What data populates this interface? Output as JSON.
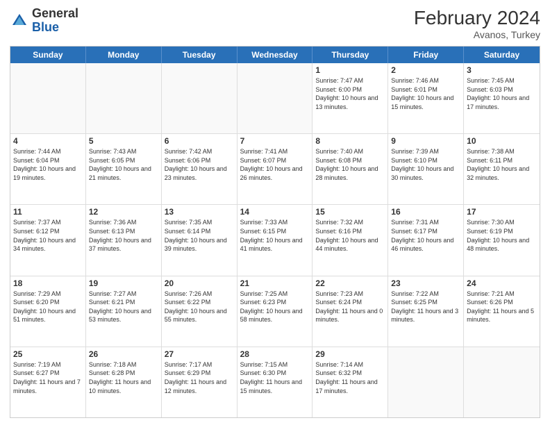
{
  "header": {
    "logo_general": "General",
    "logo_blue": "Blue",
    "month_year": "February 2024",
    "location": "Avanos, Turkey"
  },
  "weekdays": [
    "Sunday",
    "Monday",
    "Tuesday",
    "Wednesday",
    "Thursday",
    "Friday",
    "Saturday"
  ],
  "rows": [
    [
      {
        "day": "",
        "info": ""
      },
      {
        "day": "",
        "info": ""
      },
      {
        "day": "",
        "info": ""
      },
      {
        "day": "",
        "info": ""
      },
      {
        "day": "1",
        "info": "Sunrise: 7:47 AM\nSunset: 6:00 PM\nDaylight: 10 hours and 13 minutes."
      },
      {
        "day": "2",
        "info": "Sunrise: 7:46 AM\nSunset: 6:01 PM\nDaylight: 10 hours and 15 minutes."
      },
      {
        "day": "3",
        "info": "Sunrise: 7:45 AM\nSunset: 6:03 PM\nDaylight: 10 hours and 17 minutes."
      }
    ],
    [
      {
        "day": "4",
        "info": "Sunrise: 7:44 AM\nSunset: 6:04 PM\nDaylight: 10 hours and 19 minutes."
      },
      {
        "day": "5",
        "info": "Sunrise: 7:43 AM\nSunset: 6:05 PM\nDaylight: 10 hours and 21 minutes."
      },
      {
        "day": "6",
        "info": "Sunrise: 7:42 AM\nSunset: 6:06 PM\nDaylight: 10 hours and 23 minutes."
      },
      {
        "day": "7",
        "info": "Sunrise: 7:41 AM\nSunset: 6:07 PM\nDaylight: 10 hours and 26 minutes."
      },
      {
        "day": "8",
        "info": "Sunrise: 7:40 AM\nSunset: 6:08 PM\nDaylight: 10 hours and 28 minutes."
      },
      {
        "day": "9",
        "info": "Sunrise: 7:39 AM\nSunset: 6:10 PM\nDaylight: 10 hours and 30 minutes."
      },
      {
        "day": "10",
        "info": "Sunrise: 7:38 AM\nSunset: 6:11 PM\nDaylight: 10 hours and 32 minutes."
      }
    ],
    [
      {
        "day": "11",
        "info": "Sunrise: 7:37 AM\nSunset: 6:12 PM\nDaylight: 10 hours and 34 minutes."
      },
      {
        "day": "12",
        "info": "Sunrise: 7:36 AM\nSunset: 6:13 PM\nDaylight: 10 hours and 37 minutes."
      },
      {
        "day": "13",
        "info": "Sunrise: 7:35 AM\nSunset: 6:14 PM\nDaylight: 10 hours and 39 minutes."
      },
      {
        "day": "14",
        "info": "Sunrise: 7:33 AM\nSunset: 6:15 PM\nDaylight: 10 hours and 41 minutes."
      },
      {
        "day": "15",
        "info": "Sunrise: 7:32 AM\nSunset: 6:16 PM\nDaylight: 10 hours and 44 minutes."
      },
      {
        "day": "16",
        "info": "Sunrise: 7:31 AM\nSunset: 6:17 PM\nDaylight: 10 hours and 46 minutes."
      },
      {
        "day": "17",
        "info": "Sunrise: 7:30 AM\nSunset: 6:19 PM\nDaylight: 10 hours and 48 minutes."
      }
    ],
    [
      {
        "day": "18",
        "info": "Sunrise: 7:29 AM\nSunset: 6:20 PM\nDaylight: 10 hours and 51 minutes."
      },
      {
        "day": "19",
        "info": "Sunrise: 7:27 AM\nSunset: 6:21 PM\nDaylight: 10 hours and 53 minutes."
      },
      {
        "day": "20",
        "info": "Sunrise: 7:26 AM\nSunset: 6:22 PM\nDaylight: 10 hours and 55 minutes."
      },
      {
        "day": "21",
        "info": "Sunrise: 7:25 AM\nSunset: 6:23 PM\nDaylight: 10 hours and 58 minutes."
      },
      {
        "day": "22",
        "info": "Sunrise: 7:23 AM\nSunset: 6:24 PM\nDaylight: 11 hours and 0 minutes."
      },
      {
        "day": "23",
        "info": "Sunrise: 7:22 AM\nSunset: 6:25 PM\nDaylight: 11 hours and 3 minutes."
      },
      {
        "day": "24",
        "info": "Sunrise: 7:21 AM\nSunset: 6:26 PM\nDaylight: 11 hours and 5 minutes."
      }
    ],
    [
      {
        "day": "25",
        "info": "Sunrise: 7:19 AM\nSunset: 6:27 PM\nDaylight: 11 hours and 7 minutes."
      },
      {
        "day": "26",
        "info": "Sunrise: 7:18 AM\nSunset: 6:28 PM\nDaylight: 11 hours and 10 minutes."
      },
      {
        "day": "27",
        "info": "Sunrise: 7:17 AM\nSunset: 6:29 PM\nDaylight: 11 hours and 12 minutes."
      },
      {
        "day": "28",
        "info": "Sunrise: 7:15 AM\nSunset: 6:30 PM\nDaylight: 11 hours and 15 minutes."
      },
      {
        "day": "29",
        "info": "Sunrise: 7:14 AM\nSunset: 6:32 PM\nDaylight: 11 hours and 17 minutes."
      },
      {
        "day": "",
        "info": ""
      },
      {
        "day": "",
        "info": ""
      }
    ]
  ]
}
